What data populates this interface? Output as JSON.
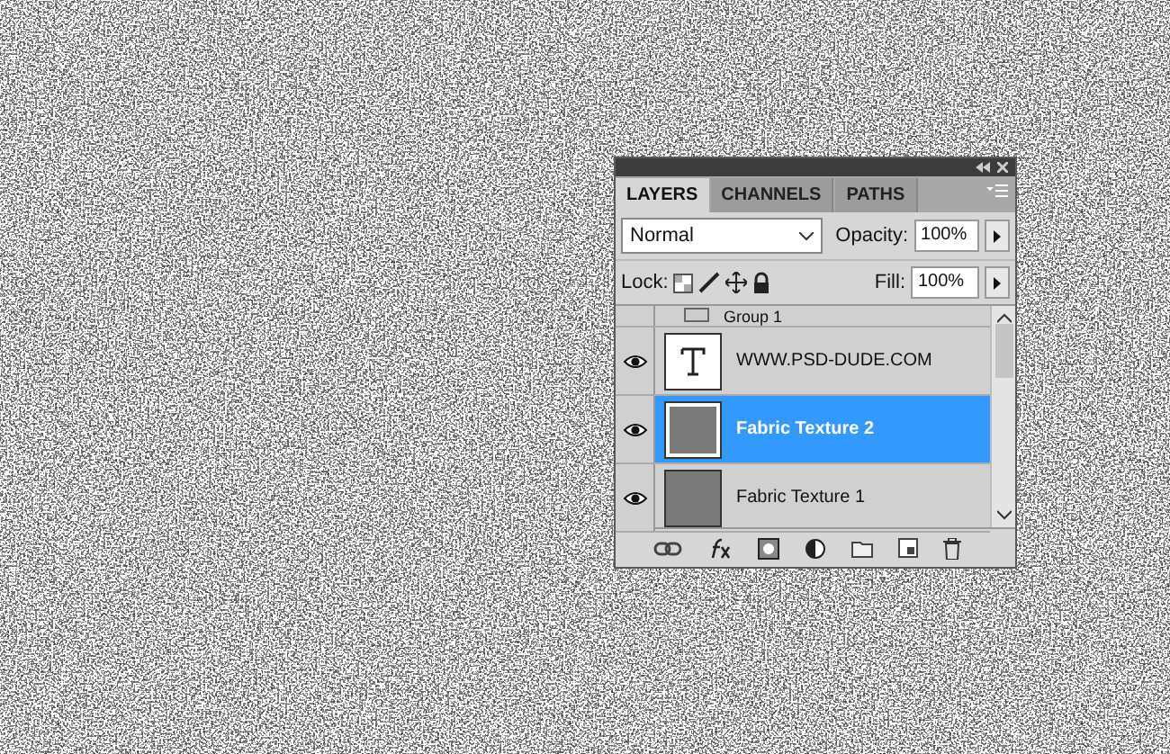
{
  "panel": {
    "tabs": [
      {
        "label": "LAYERS",
        "selected": true
      },
      {
        "label": "CHANNELS",
        "selected": false
      },
      {
        "label": "PATHS",
        "selected": false
      }
    ],
    "blend_mode": "Normal",
    "opacity_label": "Opacity:",
    "opacity": "100%",
    "lock_label": "Lock:",
    "fill_label": "Fill:",
    "fill": "100%",
    "layers": [
      {
        "kind": "group",
        "name": "Group 1",
        "visible": false,
        "selected": false
      },
      {
        "kind": "text",
        "name": "WWW.PSD-DUDE.COM",
        "visible": true,
        "selected": false
      },
      {
        "kind": "pixel",
        "name": "Fabric Texture 2",
        "visible": true,
        "selected": true
      },
      {
        "kind": "pixel",
        "name": "Fabric Texture 1",
        "visible": true,
        "selected": false
      }
    ]
  }
}
